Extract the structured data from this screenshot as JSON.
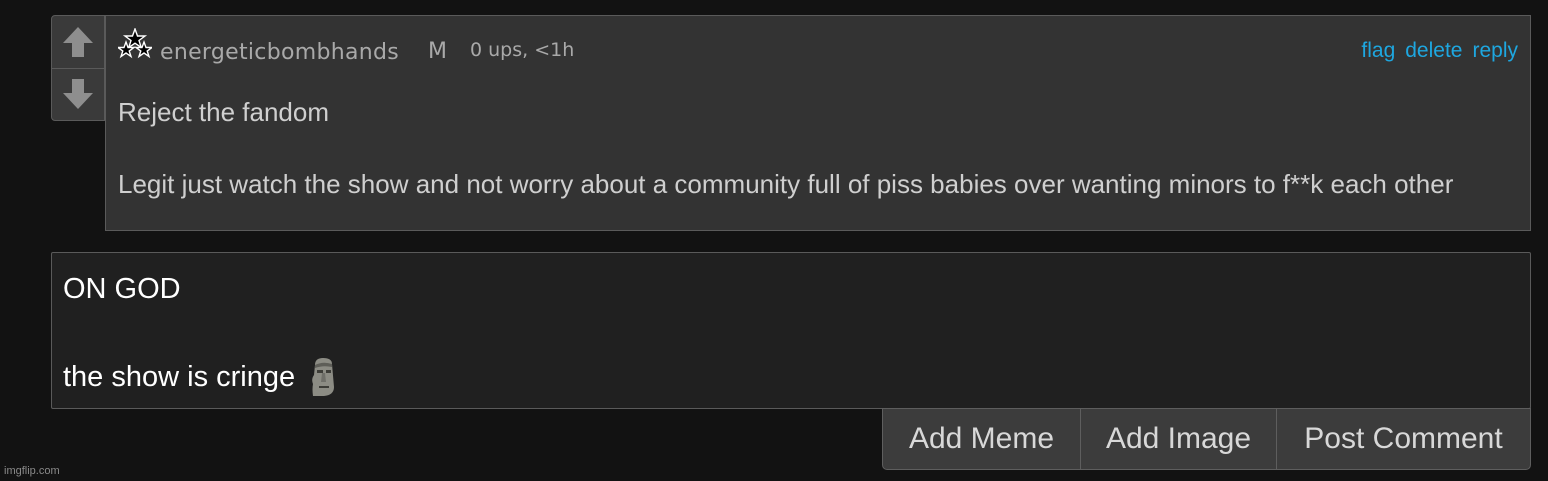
{
  "comment": {
    "username": "energeticbombhands",
    "gender": "M",
    "meta": "0 ups, <1h",
    "actions": {
      "flag": "flag",
      "delete": "delete",
      "reply": "reply"
    },
    "body": {
      "line1": "Reject the fandom",
      "line2": "Legit just watch the show and not worry about a community full of piss babies over wanting minors to f**k each other"
    },
    "vote_up_icon": "arrow-up-icon",
    "vote_down_icon": "arrow-down-icon",
    "badge_icon": "three-stars-icon"
  },
  "reply_draft": {
    "line1": "ON GOD",
    "line2": "the show is cringe",
    "emoji": "moai-emoji"
  },
  "buttons": {
    "add_meme": "Add Meme",
    "add_image": "Add Image",
    "post_comment": "Post Comment"
  },
  "watermark": "imgflip.com",
  "colors": {
    "background": "#121212",
    "comment_bg": "#333333",
    "reply_bg": "#202020",
    "link": "#1ea7e0",
    "muted_text": "#a9a9a9"
  }
}
